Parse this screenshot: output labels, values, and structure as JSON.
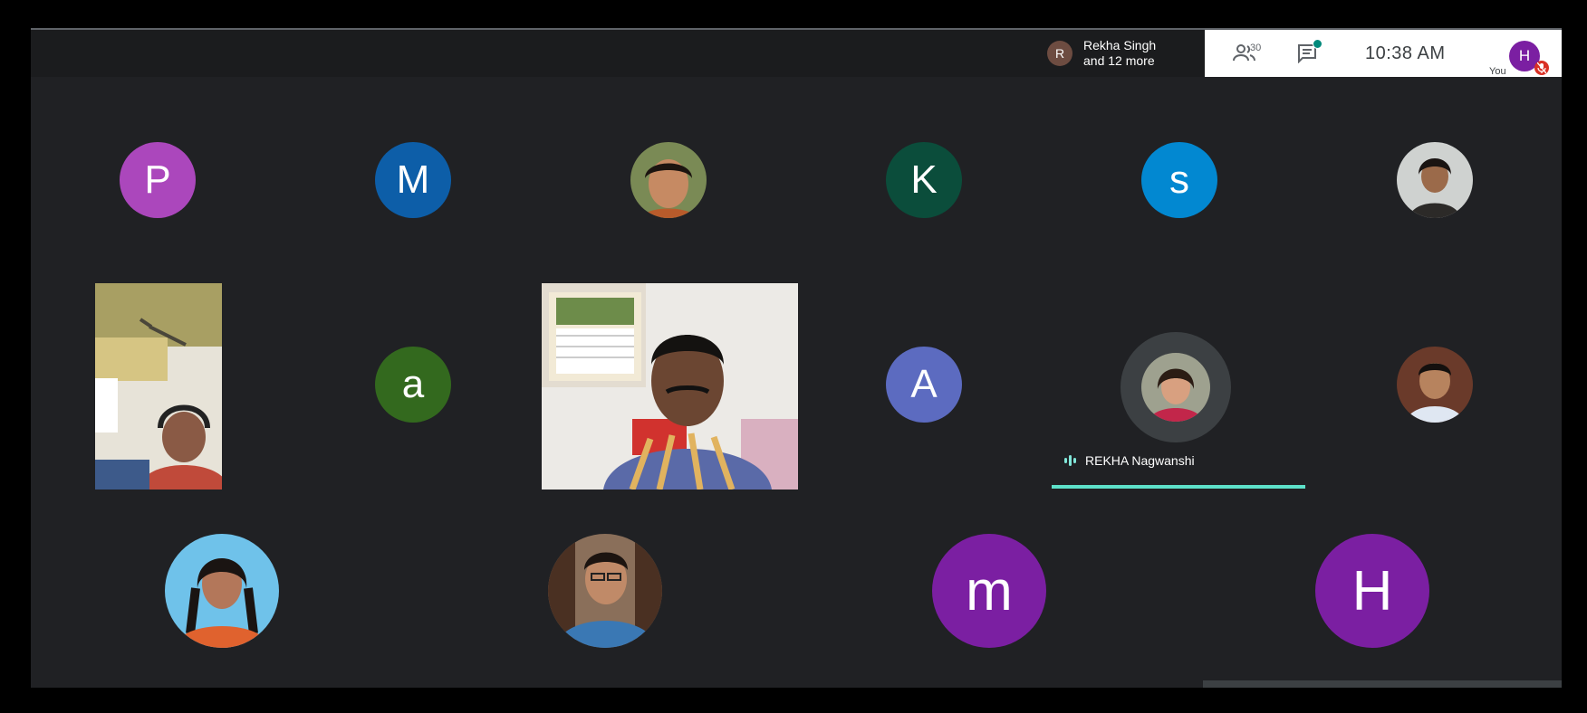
{
  "presenter": {
    "initial": "R",
    "line1": "Rekha Singh",
    "line2": "and 12 more",
    "avatar_color": "#6d4c41"
  },
  "toolbar": {
    "participants_icon": "people-icon",
    "participants_count": "30",
    "chat_icon": "chat-icon",
    "time": "10:38  AM",
    "self_label": "You",
    "self_initial": "H",
    "self_color": "#7b1fa2",
    "mic_state": "muted"
  },
  "tiles": [
    {
      "initial": "P",
      "color": "#ab47bc"
    },
    {
      "initial": "M",
      "color": "#0d5ea8"
    },
    {
      "type": "photo",
      "desc": "woman portrait"
    },
    {
      "initial": "K",
      "color": "#0b4d3b"
    },
    {
      "initial": "s",
      "color": "#0288d1"
    },
    {
      "type": "photo",
      "desc": "woman portrait"
    },
    {
      "type": "video"
    },
    {
      "initial": "a",
      "color": "#33691e"
    },
    {
      "type": "video"
    },
    {
      "initial": "A",
      "color": "#5c6bc0"
    },
    {
      "type": "photo",
      "desc": "speaking participant"
    },
    {
      "type": "photo",
      "desc": "man portrait"
    },
    {
      "type": "photo",
      "desc": "woman portrait"
    },
    {
      "type": "photo",
      "desc": "man portrait"
    },
    {
      "initial": "m",
      "color": "#7b1fa2"
    },
    {
      "initial": "H",
      "color": "#7b1fa2"
    }
  ],
  "speaker": {
    "name": "REKHA Nagwanshi",
    "accent": "#5de1c9"
  }
}
